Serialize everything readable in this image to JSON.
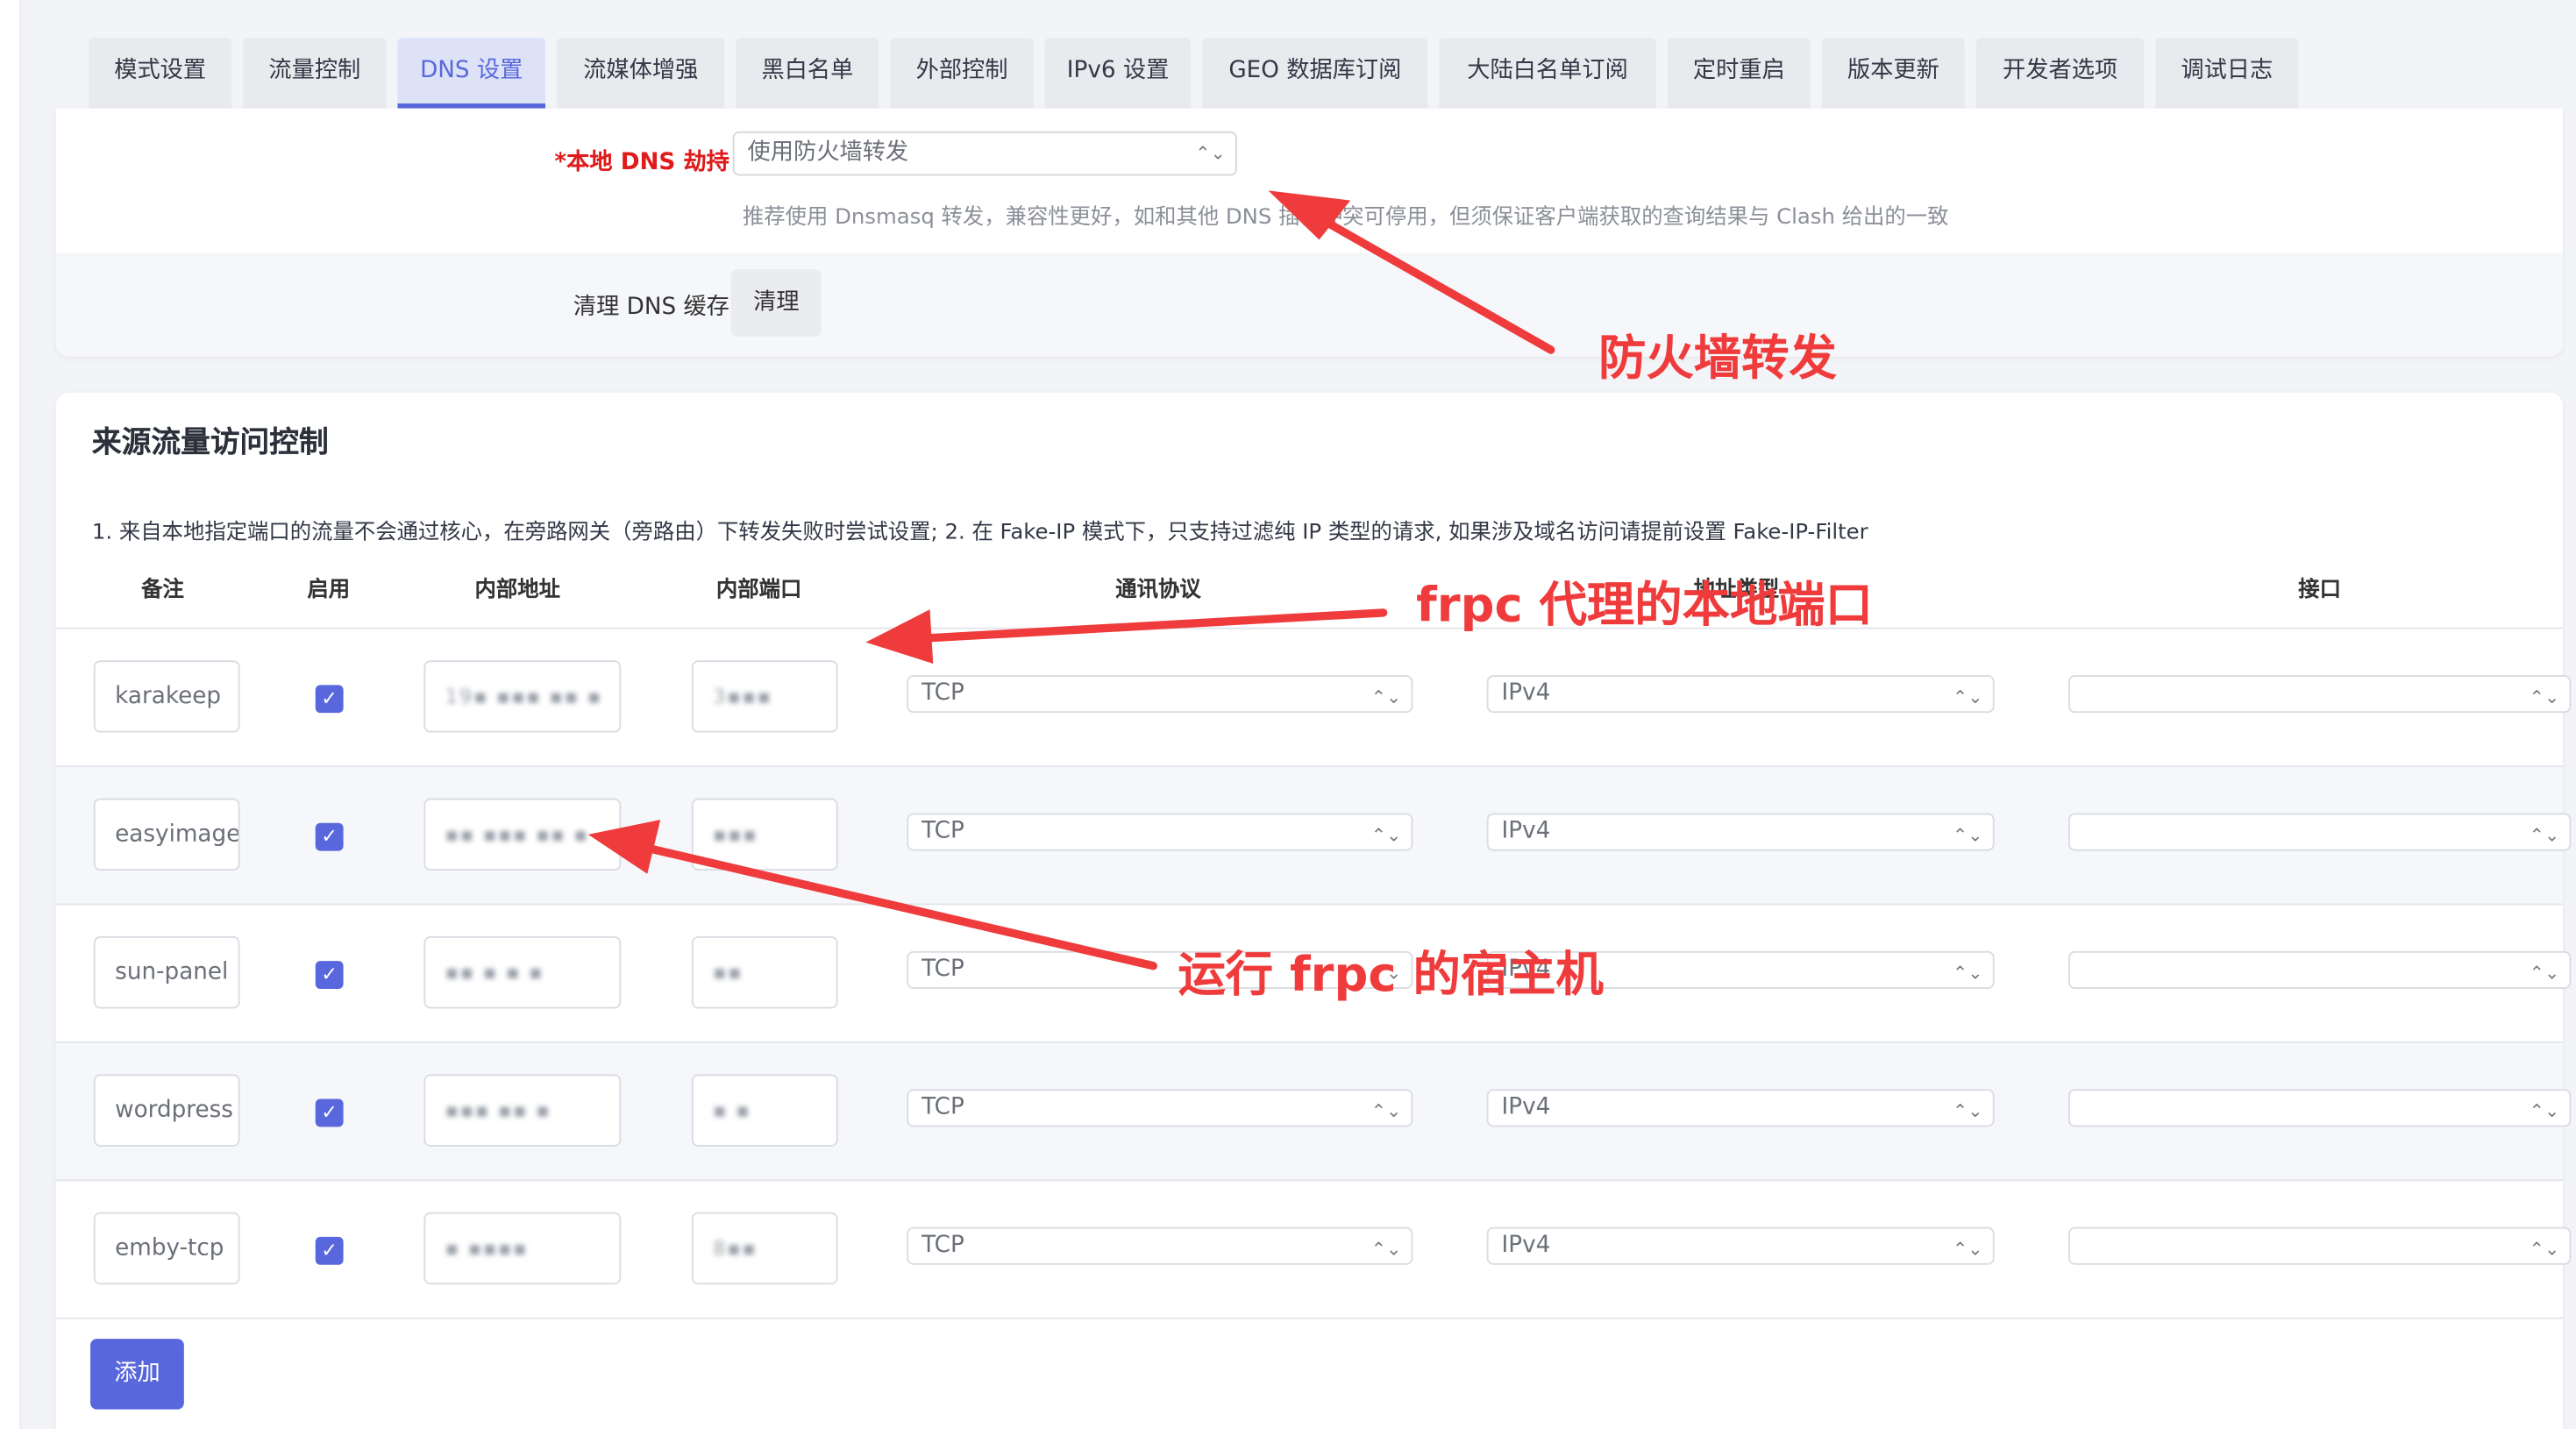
{
  "tabs": [
    {
      "label": "模式设置",
      "active": false
    },
    {
      "label": "流量控制",
      "active": false
    },
    {
      "label": "DNS 设置",
      "active": true
    },
    {
      "label": "流媒体增强",
      "active": false
    },
    {
      "label": "黑白名单",
      "active": false
    },
    {
      "label": "外部控制",
      "active": false
    },
    {
      "label": "IPv6 设置",
      "active": false
    },
    {
      "label": "GEO 数据库订阅",
      "active": false
    },
    {
      "label": "大陆白名单订阅",
      "active": false
    },
    {
      "label": "定时重启",
      "active": false
    },
    {
      "label": "版本更新",
      "active": false
    },
    {
      "label": "开发者选项",
      "active": false
    },
    {
      "label": "调试日志",
      "active": false
    }
  ],
  "dns": {
    "hijack_label": "*本地 DNS 劫持",
    "hijack_value": "使用防火墙转发",
    "help": "推荐使用 Dnsmasq 转发，兼容性更好，如和其他 DNS 插件冲突可停用，但须保证客户端获取的查询结果与 Clash 给出的一致",
    "clear_label": "清理 DNS 缓存",
    "clear_button": "清理"
  },
  "access": {
    "title": "来源流量访问控制",
    "description": "1. 来自本地指定端口的流量不会通过核心，在旁路网关（旁路由）下转发失败时尝试设置; 2. 在 Fake-IP 模式下，只支持过滤纯 IP 类型的请求, 如果涉及域名访问请提前设置 Fake-IP-Filter",
    "columns": {
      "remark": "备注",
      "enabled": "启用",
      "address": "内部地址",
      "port": "内部端口",
      "protocol": "通讯协议",
      "addr_type": "地址类型",
      "interface": "接口"
    },
    "rows": [
      {
        "remark": "karakeep",
        "enabled": true,
        "address": "19▪ ▪▪▪ ▪▪ ▪",
        "port": "3▪▪▪",
        "protocol": "TCP",
        "addr_type": "IPv4",
        "interface": ""
      },
      {
        "remark": "easyimage",
        "enabled": true,
        "address": "▪▪ ▪▪▪ ▪▪ ▪",
        "port": "▪▪▪",
        "protocol": "TCP",
        "addr_type": "IPv4",
        "interface": ""
      },
      {
        "remark": "sun-panel",
        "enabled": true,
        "address": "▪▪ ▪ ▪ ▪",
        "port": "▪▪",
        "protocol": "TCP",
        "addr_type": "IPv4",
        "interface": ""
      },
      {
        "remark": "wordpress",
        "enabled": true,
        "address": "▪▪▪ ▪▪ ▪",
        "port": "▪ ▪",
        "protocol": "TCP",
        "addr_type": "IPv4",
        "interface": ""
      },
      {
        "remark": "emby-tcp",
        "enabled": true,
        "address": "▪ ▪▪▪▪",
        "port": "8▪▪",
        "protocol": "TCP",
        "addr_type": "IPv4",
        "interface": ""
      }
    ],
    "add_button": "添加"
  },
  "annotations": {
    "firewall": "防火墙转发",
    "frpc_port": "frpc 代理的本地端口",
    "frpc_host": "运行 frpc 的宿主机"
  },
  "colors": {
    "accent": "#5868dc",
    "required": "#e01b1b",
    "annotation": "#ef3b3b"
  }
}
